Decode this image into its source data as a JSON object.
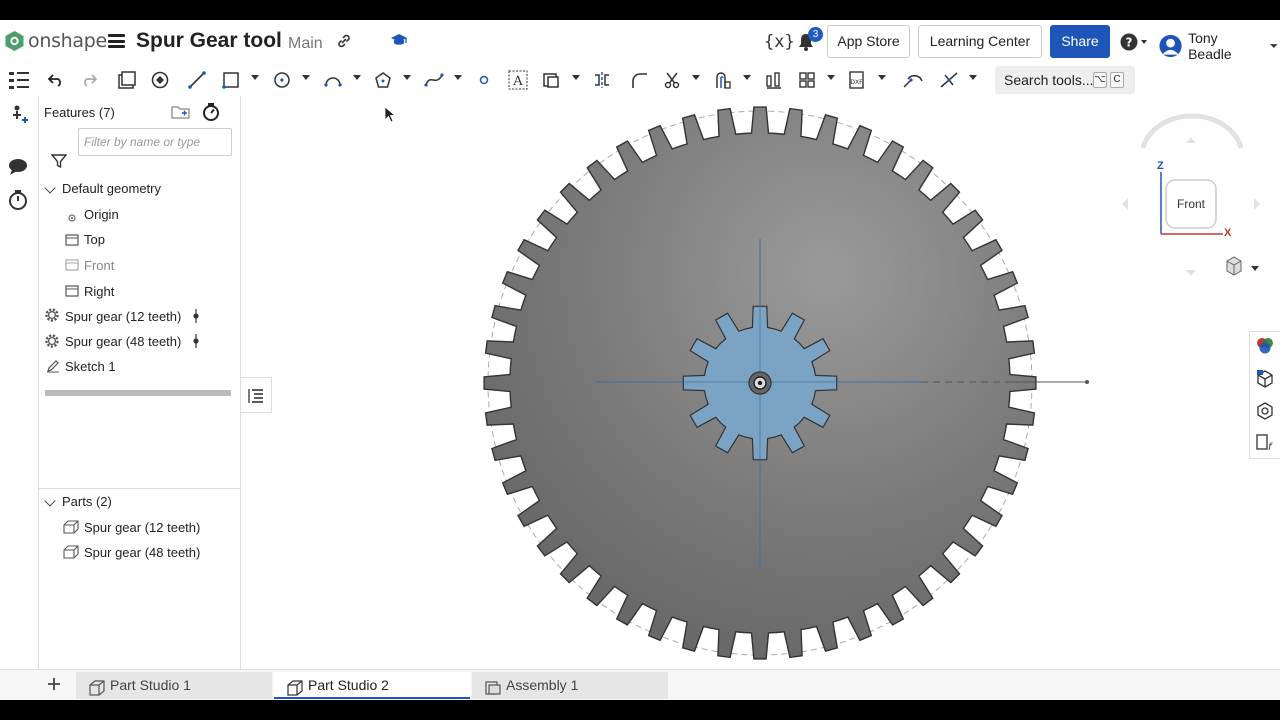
{
  "header": {
    "logo_text": "onshape",
    "document_title": "Spur Gear tool",
    "branch": "Main",
    "notification_count": "3",
    "app_store_label": "App Store",
    "learning_center_label": "Learning Center",
    "share_label": "Share",
    "user_name": "Tony Beadle",
    "variables_icon_text": "{x}"
  },
  "toolbar": {
    "search_label": "Search tools...",
    "shortcut_keys": [
      "⌥",
      "C"
    ]
  },
  "features_panel": {
    "title": "Features (7)",
    "filter_placeholder": "Filter by name or type",
    "default_geometry_label": "Default geometry",
    "geometry_items": [
      "Origin",
      "Top",
      "Front",
      "Right"
    ],
    "features": [
      "Spur gear (12 teeth)",
      "Spur gear (48 teeth)",
      "Sketch 1"
    ],
    "parts_title": "Parts (2)",
    "parts": [
      "Spur gear (12 teeth)",
      "Spur gear (48 teeth)"
    ]
  },
  "viewport": {
    "view_cube_face": "Front",
    "axis_z": "Z",
    "axis_x": "X",
    "large_gear_color": "#7c7c7c",
    "small_gear_color": "#7aa3c4",
    "large_gear_teeth": 48,
    "small_gear_teeth": 12
  },
  "tabs": [
    "Part Studio 1",
    "Part Studio 2",
    "Assembly 1"
  ],
  "active_tab": "Part Studio 2",
  "colors": {
    "accent": "#1d56b8",
    "logo_green": "#4a9f6a"
  }
}
